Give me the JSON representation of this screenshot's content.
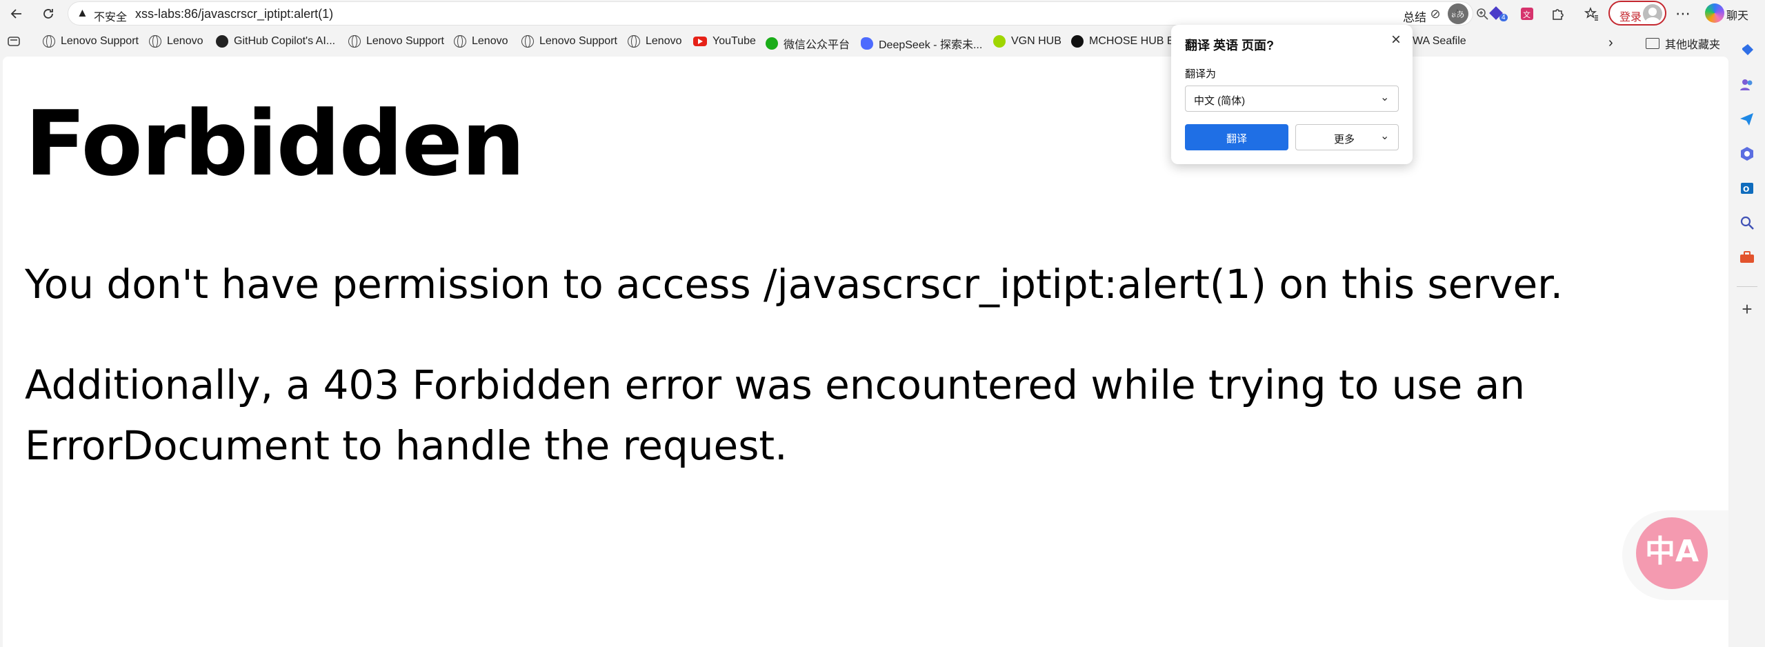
{
  "toolbar": {
    "back_icon": "back-arrow-icon",
    "refresh_icon": "refresh-icon",
    "insecure_label": "不安全",
    "url": "xss-labs:86/javascrscr_iptipt:alert(1)",
    "summarize_label": "总结",
    "translate_icon_text": "aあ",
    "login_label": "登录",
    "chat_label": "聊天",
    "extension_badge": "4"
  },
  "bookmarks": [
    {
      "label": "Lenovo Support",
      "icon": "globe"
    },
    {
      "label": "Lenovo",
      "icon": "globe"
    },
    {
      "label": "GitHub Copilot's AI...",
      "icon": "github"
    },
    {
      "label": "Lenovo Support",
      "icon": "globe"
    },
    {
      "label": "Lenovo",
      "icon": "globe"
    },
    {
      "label": "Lenovo Support",
      "icon": "globe"
    },
    {
      "label": "Lenovo",
      "icon": "globe"
    },
    {
      "label": "YouTube",
      "icon": "youtube"
    },
    {
      "label": "微信公众平台",
      "icon": "wechat"
    },
    {
      "label": "DeepSeek - 探索未...",
      "icon": "deepseek"
    },
    {
      "label": "VGN HUB",
      "icon": "vgn"
    },
    {
      "label": "MCHOSE HUB Bet",
      "icon": "mchose"
    },
    {
      "label": "WA Seafile",
      "icon": "none"
    }
  ],
  "other_bookmarks_label": "其他收藏夹",
  "page": {
    "heading": "Forbidden",
    "paragraph1": "You don't have permission to access /javascrscr_iptipt:alert(1) on this server.",
    "paragraph2": "Additionally, a 403 Forbidden error was encountered while trying to use an ErrorDocument to handle the request."
  },
  "translate_popup": {
    "title": "翻译 英语 页面?",
    "translate_to_label": "翻译为",
    "selected_language": "中文 (简体)",
    "translate_button": "翻译",
    "more_button": "更多",
    "close_icon": "close-icon"
  },
  "floating_translate": {
    "text": "中A"
  },
  "colors": {
    "translate_blue": "#1f6fe5",
    "login_red": "#c4272f",
    "float_pink": "#f49ab0"
  }
}
